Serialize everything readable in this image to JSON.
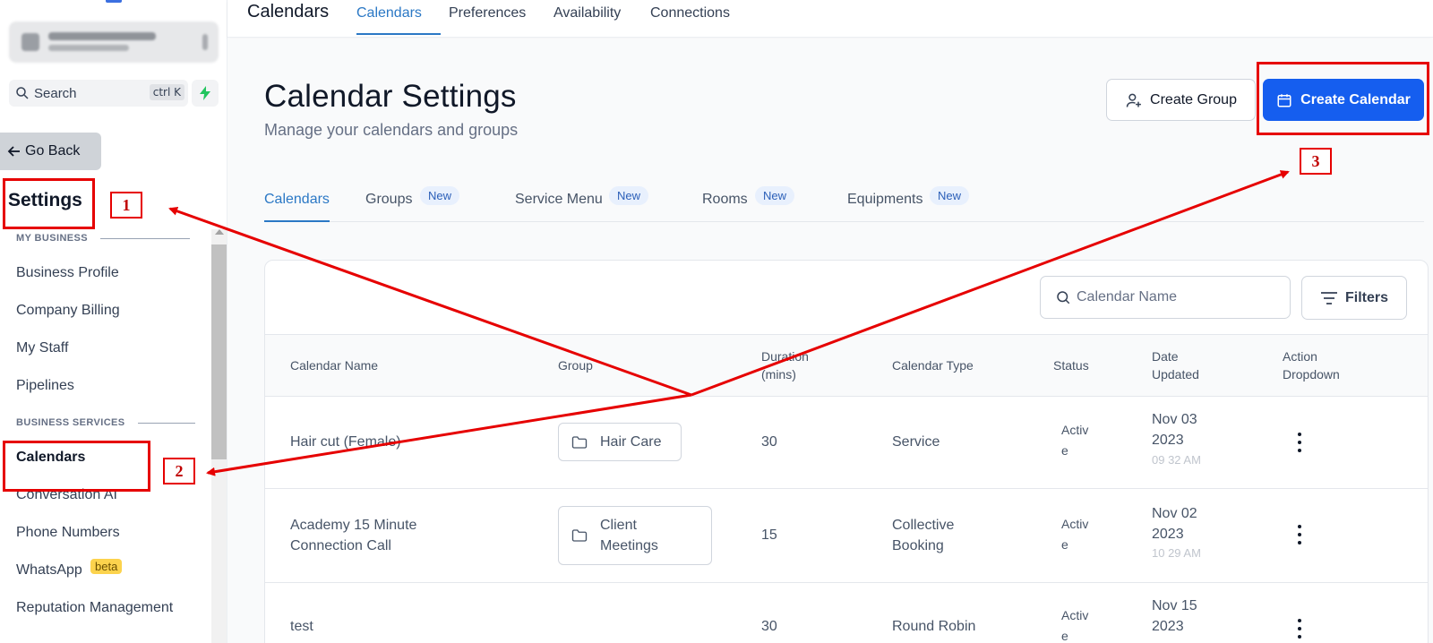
{
  "sidebar": {
    "search_label": "Search",
    "search_shortcut": "ctrl K",
    "go_back": "Go Back",
    "title": "Settings",
    "sections": [
      {
        "label": "MY BUSINESS",
        "items": [
          "Business Profile",
          "Company Billing",
          "My Staff",
          "Pipelines"
        ]
      },
      {
        "label": "BUSINESS SERVICES",
        "items": [
          "Calendars",
          "Conversation AI",
          "Phone Numbers",
          "WhatsApp",
          "Reputation Management"
        ]
      }
    ],
    "active_item": "Calendars",
    "whatsapp_badge": "beta"
  },
  "topnav": {
    "title": "Calendars",
    "tabs": [
      "Calendars",
      "Preferences",
      "Availability",
      "Connections"
    ],
    "active_tab": "Calendars"
  },
  "page": {
    "title": "Calendar Settings",
    "subtitle": "Manage your calendars and groups",
    "create_group": "Create Group",
    "create_calendar": "Create Calendar"
  },
  "subtabs": [
    {
      "label": "Calendars",
      "badge": null
    },
    {
      "label": "Groups",
      "badge": "New"
    },
    {
      "label": "Service Menu",
      "badge": "New"
    },
    {
      "label": "Rooms",
      "badge": "New"
    },
    {
      "label": "Equipments",
      "badge": "New"
    }
  ],
  "table": {
    "search_placeholder": "Calendar Name",
    "filters_label": "Filters",
    "headers": {
      "name": "Calendar Name",
      "group": "Group",
      "duration_1": "Duration",
      "duration_2": "(mins)",
      "type": "Calendar Type",
      "status": "Status",
      "date_1": "Date",
      "date_2": "Updated",
      "action_1": "Action",
      "action_2": "Dropdown"
    },
    "rows": [
      {
        "name_1": "Hair cut (Female)",
        "name_2": "",
        "group_1": "Hair Care",
        "group_2": "",
        "duration": "30",
        "type_1": "Service",
        "type_2": "",
        "status_1": "Activ",
        "status_2": "e",
        "date_1": "Nov 03",
        "date_2": "2023",
        "time": "09 32 AM"
      },
      {
        "name_1": "Academy 15 Minute",
        "name_2": "Connection Call",
        "group_1": "Client",
        "group_2": "Meetings",
        "duration": "15",
        "type_1": "Collective",
        "type_2": "Booking",
        "status_1": "Activ",
        "status_2": "e",
        "date_1": "Nov 02",
        "date_2": "2023",
        "time": "10 29 AM"
      },
      {
        "name_1": "test",
        "name_2": "",
        "group_1": "",
        "group_2": "",
        "duration": "30",
        "type_1": "Round Robin",
        "type_2": "",
        "status_1": "Activ",
        "status_2": "e",
        "date_1": "Nov 15",
        "date_2": "2023",
        "time": ""
      }
    ]
  },
  "annotations": {
    "label_1": "1",
    "label_2": "2",
    "label_3": "3",
    "color": "#e60000"
  },
  "colors": {
    "primary": "#155eef",
    "active_tab": "#2b78c5",
    "badge_bg": "#e8f0fd",
    "beta_bg": "#fcd34d"
  }
}
